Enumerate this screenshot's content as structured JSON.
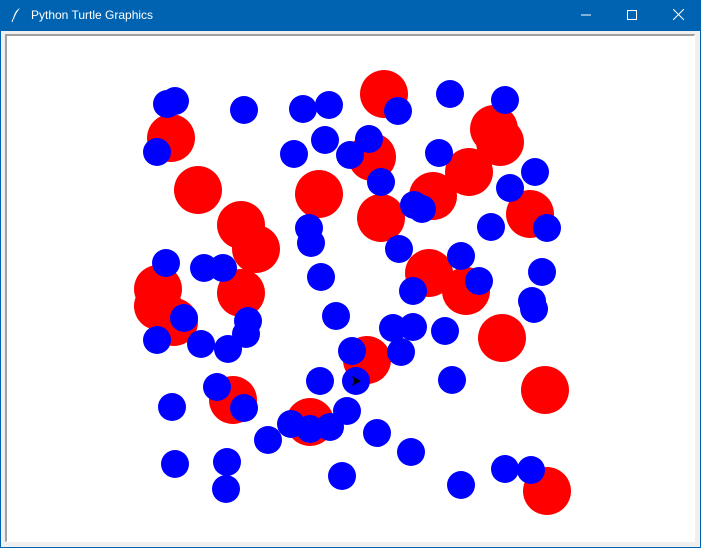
{
  "window": {
    "title": "Python Turtle Graphics",
    "icons": {
      "app": "feather-icon",
      "minimize": "minimize-icon",
      "maximize": "maximize-icon",
      "close": "close-icon"
    }
  },
  "colors": {
    "titlebar": "#0063B1",
    "large_dot": "#ff0000",
    "small_dot": "#0000ff",
    "turtle": "#000000"
  }
}
